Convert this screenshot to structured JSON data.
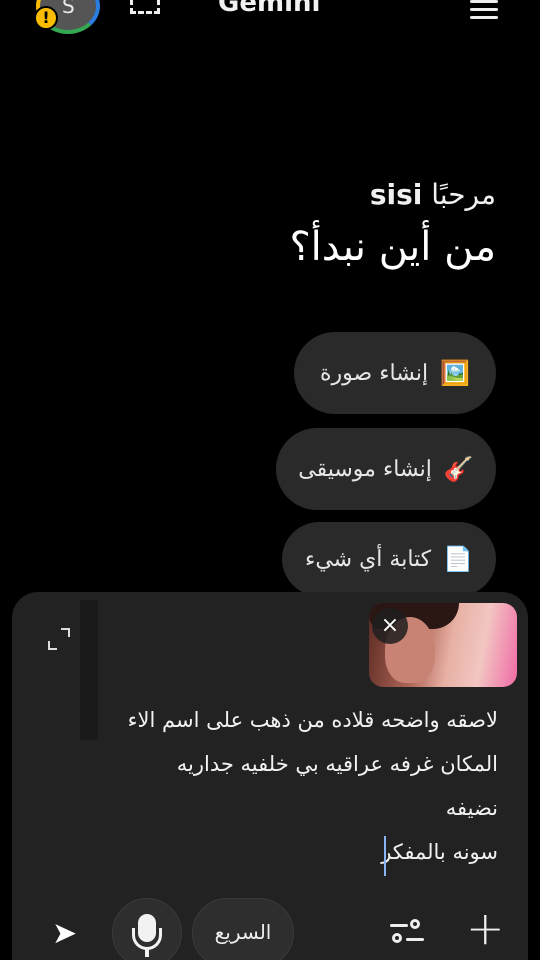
{
  "header": {
    "title": "Gemini",
    "avatar_letter": "S",
    "warning_badge": "!",
    "icons": [
      "avatar",
      "warning-icon",
      "screen-select-icon",
      "menu-icon"
    ]
  },
  "greeting": {
    "hello": "مرحبًا",
    "name": "sisi",
    "question": "من أين نبدأ؟"
  },
  "suggestions": [
    {
      "emoji": "🖼️",
      "label": "إنشاء صورة"
    },
    {
      "emoji": "🎸",
      "label": "إنشاء موسيقى"
    },
    {
      "emoji": "📄",
      "label": "كتابة أي شيء"
    }
  ],
  "composer": {
    "attachment_close": "×",
    "lines": [
      "لاصقه واضحه قلاده من ذهب على اسم الاء",
      "المكان غرفه عراقيه بي خلفيه جداريه",
      "نضيفه",
      "سونه بالمفكر"
    ]
  },
  "toolbar": {
    "mode_label": "السريع",
    "plus": "+",
    "send": "➤"
  },
  "colors": {
    "background": "#000000",
    "panel": "#222222",
    "chip": "#2a2a2a",
    "caret": "#8ab4f8"
  }
}
